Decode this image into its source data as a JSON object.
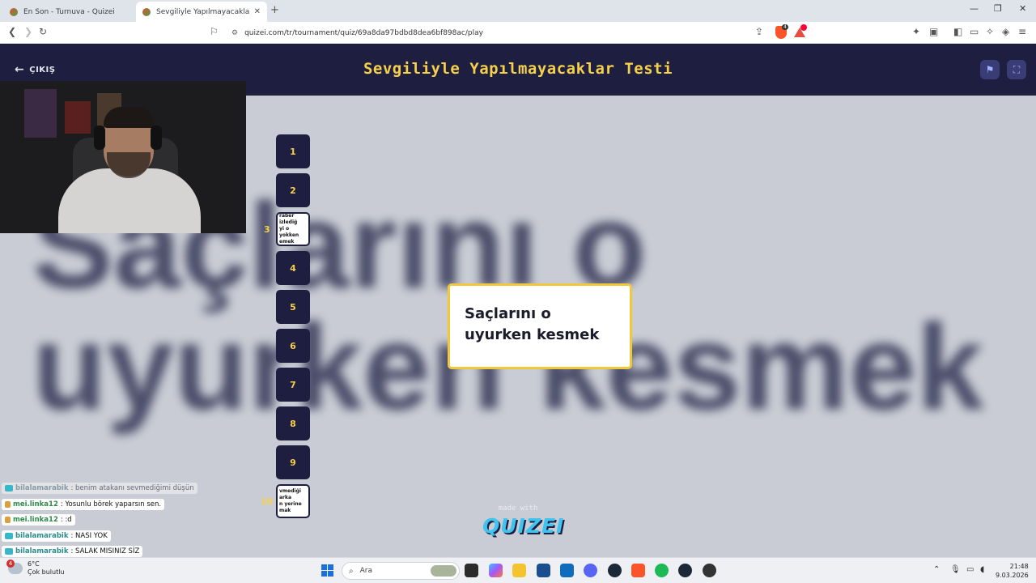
{
  "browser": {
    "tabs": [
      {
        "title": "En Son - Turnuva - Quizei"
      },
      {
        "title": "Sevgiliyle Yapılmayacaklar Testi -"
      }
    ],
    "url": "quizei.com/tr/tournament/quiz/69a8da97bdbd8dea6bf898ac/play",
    "shield_count": "4"
  },
  "quiz": {
    "exit_label": "ÇIKIŞ",
    "title": "Sevgiliyle Yapılmayacaklar Testi",
    "background_text": "Saçlarını o uyurken kesmek",
    "answer": "Saçlarını o uyurken kesmek",
    "bracket": [
      {
        "label": "1"
      },
      {
        "label": "2"
      },
      {
        "label": "raber izlediğ\nyi o yokken\nemek"
      },
      {
        "label": "4"
      },
      {
        "label": "5"
      },
      {
        "label": "6"
      },
      {
        "label": "7"
      },
      {
        "label": "8"
      },
      {
        "label": "9"
      },
      {
        "label": "vmediği arka\nn yerine\nmak"
      }
    ],
    "side_labels": {
      "three": "3",
      "ten": "10"
    },
    "made_with": "made with",
    "brand": "QUIZEI"
  },
  "chat": [
    {
      "user": "bilalamarabik",
      "message": ": benim atakanı sevmediğimi düşün"
    },
    {
      "user": "mei.linka12",
      "message": ": Yosunlu börek yaparsın sen."
    },
    {
      "user": "mei.linka12",
      "message": ": :d"
    },
    {
      "user": "bilalamarabik",
      "message": ": NASI YOK"
    },
    {
      "user": "bilalamarabik",
      "message": ": SALAK MISINIZ SİZ"
    }
  ],
  "taskbar": {
    "weather_temp": "6°C",
    "weather_desc": "Çok bulutlu",
    "weather_badge": "4",
    "search_placeholder": "Ara",
    "time": "21:48",
    "date": "9.03.2026"
  },
  "colors": {
    "header_bg": "#1e1f40",
    "title_yellow": "#f7d04a",
    "card_border": "#f0c83a",
    "brand_blue": "#3fc4f0"
  }
}
